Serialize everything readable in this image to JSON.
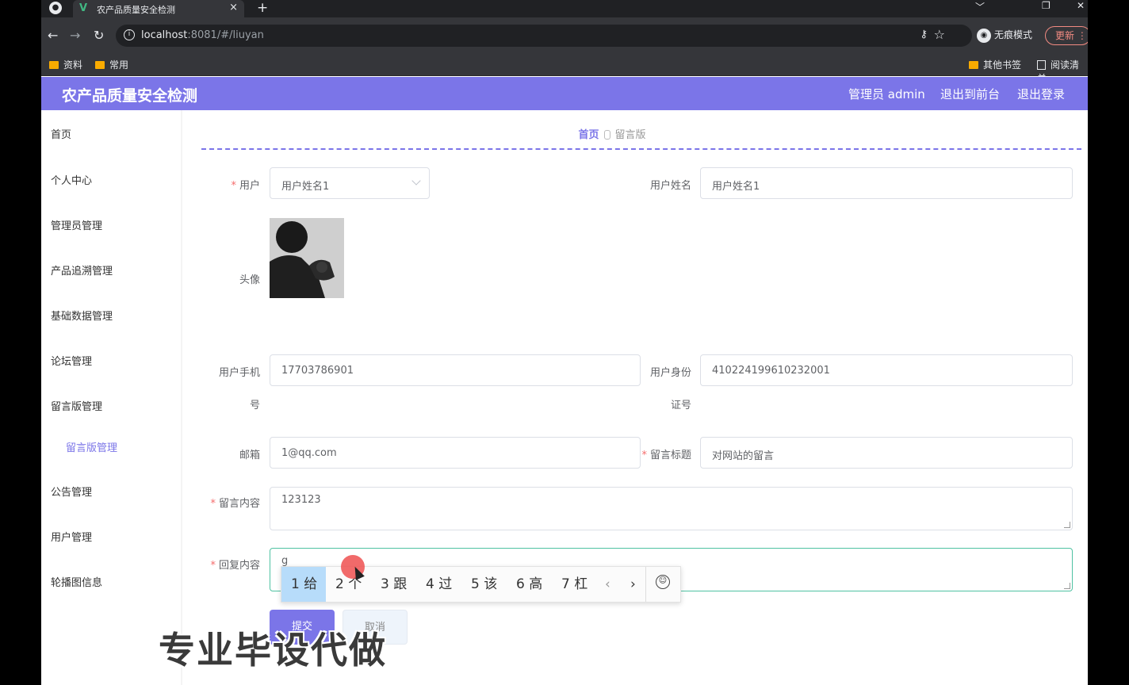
{
  "browser": {
    "tab_title": "农产品质量安全检测",
    "tab_close": "×",
    "new_tab": "+",
    "url_host": "localhost",
    "url_rest": ":8081/#/liuyan",
    "incognito_label": "无痕模式",
    "update_label": "更新",
    "bookmarks": [
      "资料",
      "常用"
    ],
    "bookmarks_right": [
      "其他书签",
      "阅读清单"
    ],
    "window_controls": [
      "﹀",
      "❐",
      "✕"
    ]
  },
  "header": {
    "brand": "农产品质量安全检测",
    "admin": "管理员 admin",
    "to_front": "退出到前台",
    "logout": "退出登录",
    "color": "#7b75e8"
  },
  "sidebar": {
    "items": [
      "首页",
      "个人中心",
      "管理员管理",
      "产品追溯管理",
      "基础数据管理",
      "论坛管理",
      "留言版管理"
    ],
    "sub_item": "留言版管理",
    "items_after": [
      "公告管理",
      "用户管理",
      "轮播图信息"
    ]
  },
  "breadcrumb": {
    "home": "首页",
    "current": "留言版"
  },
  "form": {
    "user_label": "用户",
    "user_value": "用户姓名1",
    "username_label": "用户姓名",
    "username_value": "用户姓名1",
    "avatar_label": "头像",
    "phone_label_1": "用户手机",
    "phone_label_2": "号",
    "phone_value": "17703786901",
    "idcard_label_1": "用户身份",
    "idcard_label_2": "证号",
    "idcard_value": "410224199610232001",
    "email_label": "邮箱",
    "email_value": "1@qq.com",
    "title_label": "留言标题",
    "title_value": "对网站的留言",
    "content_label": "留言内容",
    "content_value": "123123",
    "reply_label": "回复内容",
    "reply_value": "g",
    "required_mark": "*",
    "submit": "提交",
    "cancel": "取消"
  },
  "ime": {
    "candidates": [
      "1 给",
      "2 个",
      "3 跟",
      "4 过",
      "5 该",
      "6 高",
      "7 杠"
    ],
    "prev": "‹",
    "next": "›",
    "emoji": "☺"
  },
  "watermark": "专业毕设代做"
}
